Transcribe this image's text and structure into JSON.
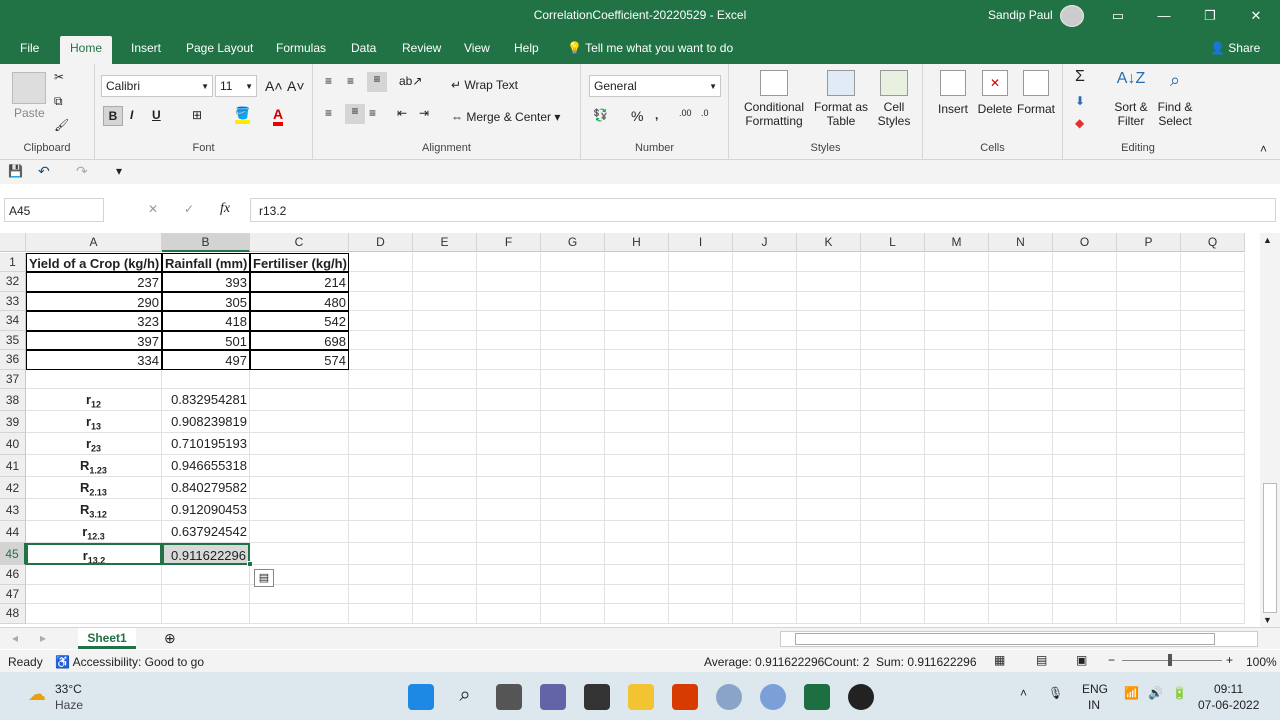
{
  "window": {
    "title": "CorrelationCoefficient-20220529  -  Excel",
    "user": "Sandip Paul"
  },
  "menu": [
    "File",
    "Home",
    "Insert",
    "Page Layout",
    "Formulas",
    "Data",
    "Review",
    "View",
    "Help"
  ],
  "tell": "Tell me what you want to do",
  "share": "Share",
  "ribbon": {
    "clipboard": {
      "paste": "Paste",
      "label": "Clipboard"
    },
    "font": {
      "name": "Calibri",
      "size": "11",
      "label": "Font"
    },
    "alignment": {
      "wrap": "Wrap Text",
      "merge": "Merge & Center",
      "label": "Alignment"
    },
    "number": {
      "format": "General",
      "label": "Number"
    },
    "styles": {
      "cond1": "Conditional",
      "cond2": "Formatting",
      "fmt1": "Format as",
      "fmt2": "Table",
      "cell1": "Cell",
      "cell2": "Styles",
      "label": "Styles"
    },
    "cells": {
      "insert": "Insert",
      "delete": "Delete",
      "format": "Format",
      "label": "Cells"
    },
    "editing": {
      "sort1": "Sort &",
      "sort2": "Filter",
      "find1": "Find &",
      "find2": "Select",
      "label": "Editing"
    }
  },
  "namebox": "A45",
  "formula": "r13.2",
  "columns": [
    "A",
    "B",
    "C",
    "D",
    "E",
    "F",
    "G",
    "H",
    "I",
    "J",
    "K",
    "L",
    "M",
    "N",
    "O",
    "P",
    "Q"
  ],
  "header_row": {
    "num": "1",
    "a": "Yield of a Crop (kg/h)",
    "b": "Rainfall (mm)",
    "c": "Fertiliser (kg/h)"
  },
  "rows": [
    {
      "num": "32",
      "a": "237",
      "b": "393",
      "c": "214"
    },
    {
      "num": "33",
      "a": "290",
      "b": "305",
      "c": "480"
    },
    {
      "num": "34",
      "a": "323",
      "b": "418",
      "c": "542"
    },
    {
      "num": "35",
      "a": "397",
      "b": "501",
      "c": "698"
    },
    {
      "num": "36",
      "a": "334",
      "b": "497",
      "c": "574"
    },
    {
      "num": "37",
      "a": "",
      "b": "",
      "c": ""
    },
    {
      "num": "38",
      "a": "r",
      "sub": "12",
      "b": "0.832954281"
    },
    {
      "num": "39",
      "a": "r",
      "sub": "13",
      "b": "0.908239819"
    },
    {
      "num": "40",
      "a": "r",
      "sub": "23",
      "b": "0.710195193"
    },
    {
      "num": "41",
      "a": "R",
      "sub": "1.23",
      "b": "0.946655318"
    },
    {
      "num": "42",
      "a": "R",
      "sub": "2.13",
      "b": "0.840279582"
    },
    {
      "num": "43",
      "a": "R",
      "sub": "3.12",
      "b": "0.912090453"
    },
    {
      "num": "44",
      "a": "r",
      "sub": "12.3",
      "b": "0.637924542"
    },
    {
      "num": "45",
      "a": "r",
      "sub": "13.2",
      "b": "0.911622296"
    },
    {
      "num": "46"
    },
    {
      "num": "47"
    },
    {
      "num": "48"
    }
  ],
  "sheet": "Sheet1",
  "status": {
    "ready": "Ready",
    "access": "Accessibility: Good to go",
    "avg": "Average: 0.911622296",
    "count": "Count: 2",
    "sum": "Sum: 0.911622296",
    "zoom": "100%"
  },
  "taskbar": {
    "temp": "33°C",
    "weather": "Haze",
    "lang1": "ENG",
    "lang2": "IN",
    "time": "09:11",
    "date": "07-06-2022"
  }
}
